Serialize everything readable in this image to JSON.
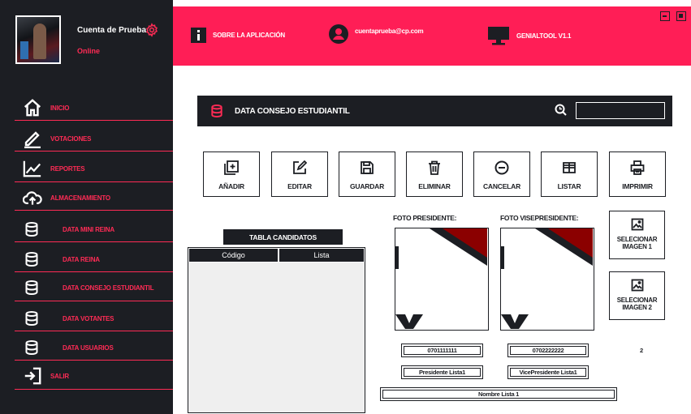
{
  "profile": {
    "name": "Cuenta de Prueba",
    "status": "Online"
  },
  "nav": {
    "items": [
      {
        "label": "INICIO",
        "icon": "home-icon"
      },
      {
        "label": "VOTACIONES",
        "icon": "pencil-icon"
      },
      {
        "label": "REPORTES",
        "icon": "chart-line-icon"
      },
      {
        "label": "ALMACENAMIENTO",
        "icon": "cloud-upload-icon"
      },
      {
        "label": "DATA MINI REINA",
        "icon": "database-icon"
      },
      {
        "label": "DATA REINA",
        "icon": "database-icon"
      },
      {
        "label": "DATA CONSEJO ESTUDIANTIL",
        "icon": "database-icon"
      },
      {
        "label": "DATA VOTANTES",
        "icon": "database-icon"
      },
      {
        "label": "DATA USUARIOS",
        "icon": "database-icon"
      },
      {
        "label": "SALIR",
        "icon": "logout-icon"
      }
    ]
  },
  "header": {
    "about": "SOBRE LA APLICACIÓN",
    "email": "cuentaprueba@cp.com",
    "app_version": "GENIALTOOL V1.1"
  },
  "section": {
    "title": "DATA CONSEJO ESTUDIANTIL",
    "search_value": ""
  },
  "actions": [
    {
      "label": "AÑADIR",
      "icon": "add-icon"
    },
    {
      "label": "EDITAR",
      "icon": "edit-icon"
    },
    {
      "label": "GUARDAR",
      "icon": "save-icon"
    },
    {
      "label": "ELIMINAR",
      "icon": "trash-icon"
    },
    {
      "label": "CANCELAR",
      "icon": "cancel-icon"
    },
    {
      "label": "LISTAR",
      "icon": "table-icon"
    },
    {
      "label": "IMPRIMIR",
      "icon": "print-icon"
    }
  ],
  "table": {
    "title": "TABLA CANDIDATOS",
    "columns": [
      "Código",
      "Lista"
    ]
  },
  "photos": {
    "president_label": "FOTO PRESIDENTE:",
    "vice_label": "FOTO VISEPRESIDENTE:",
    "select1": "SELECIONAR IMAGEN 1",
    "select2": "SELECIONAR IMAGEN 2"
  },
  "fields": {
    "president_id": "0701111111",
    "vice_id": "0702222222",
    "president_name": "Presidente Lista1",
    "vice_name": "VicePresidente Lista1",
    "list_name": "Nombre Lista 1",
    "count": "2"
  },
  "colors": {
    "accent": "#ff1e56",
    "dark": "#1c1e23",
    "photo_red": "#8b0000"
  }
}
